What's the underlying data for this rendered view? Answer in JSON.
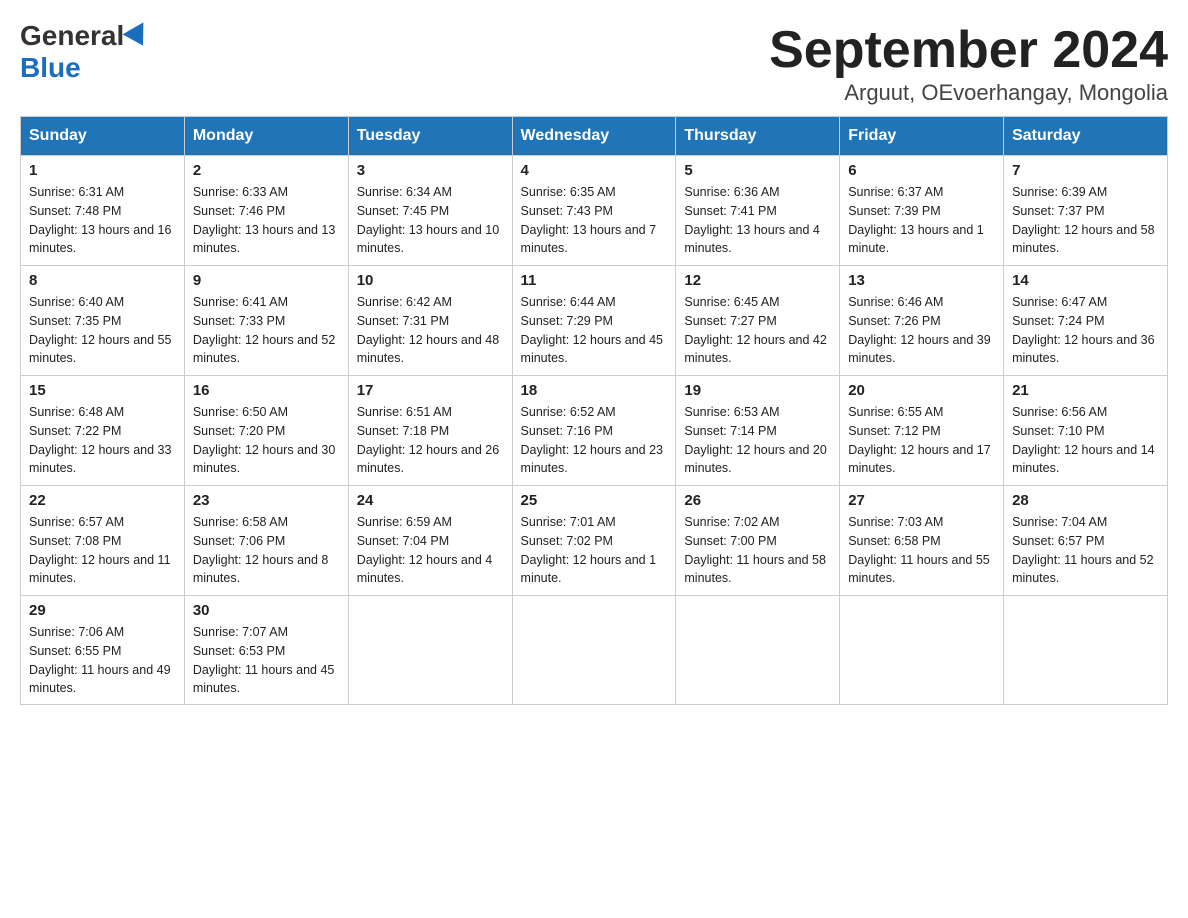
{
  "header": {
    "logo_general": "General",
    "logo_blue": "Blue",
    "month_title": "September 2024",
    "location": "Arguut, OEvoerhangay, Mongolia"
  },
  "weekdays": [
    "Sunday",
    "Monday",
    "Tuesday",
    "Wednesday",
    "Thursday",
    "Friday",
    "Saturday"
  ],
  "weeks": [
    [
      {
        "day": "1",
        "sunrise": "6:31 AM",
        "sunset": "7:48 PM",
        "daylight": "13 hours and 16 minutes."
      },
      {
        "day": "2",
        "sunrise": "6:33 AM",
        "sunset": "7:46 PM",
        "daylight": "13 hours and 13 minutes."
      },
      {
        "day": "3",
        "sunrise": "6:34 AM",
        "sunset": "7:45 PM",
        "daylight": "13 hours and 10 minutes."
      },
      {
        "day": "4",
        "sunrise": "6:35 AM",
        "sunset": "7:43 PM",
        "daylight": "13 hours and 7 minutes."
      },
      {
        "day": "5",
        "sunrise": "6:36 AM",
        "sunset": "7:41 PM",
        "daylight": "13 hours and 4 minutes."
      },
      {
        "day": "6",
        "sunrise": "6:37 AM",
        "sunset": "7:39 PM",
        "daylight": "13 hours and 1 minute."
      },
      {
        "day": "7",
        "sunrise": "6:39 AM",
        "sunset": "7:37 PM",
        "daylight": "12 hours and 58 minutes."
      }
    ],
    [
      {
        "day": "8",
        "sunrise": "6:40 AM",
        "sunset": "7:35 PM",
        "daylight": "12 hours and 55 minutes."
      },
      {
        "day": "9",
        "sunrise": "6:41 AM",
        "sunset": "7:33 PM",
        "daylight": "12 hours and 52 minutes."
      },
      {
        "day": "10",
        "sunrise": "6:42 AM",
        "sunset": "7:31 PM",
        "daylight": "12 hours and 48 minutes."
      },
      {
        "day": "11",
        "sunrise": "6:44 AM",
        "sunset": "7:29 PM",
        "daylight": "12 hours and 45 minutes."
      },
      {
        "day": "12",
        "sunrise": "6:45 AM",
        "sunset": "7:27 PM",
        "daylight": "12 hours and 42 minutes."
      },
      {
        "day": "13",
        "sunrise": "6:46 AM",
        "sunset": "7:26 PM",
        "daylight": "12 hours and 39 minutes."
      },
      {
        "day": "14",
        "sunrise": "6:47 AM",
        "sunset": "7:24 PM",
        "daylight": "12 hours and 36 minutes."
      }
    ],
    [
      {
        "day": "15",
        "sunrise": "6:48 AM",
        "sunset": "7:22 PM",
        "daylight": "12 hours and 33 minutes."
      },
      {
        "day": "16",
        "sunrise": "6:50 AM",
        "sunset": "7:20 PM",
        "daylight": "12 hours and 30 minutes."
      },
      {
        "day": "17",
        "sunrise": "6:51 AM",
        "sunset": "7:18 PM",
        "daylight": "12 hours and 26 minutes."
      },
      {
        "day": "18",
        "sunrise": "6:52 AM",
        "sunset": "7:16 PM",
        "daylight": "12 hours and 23 minutes."
      },
      {
        "day": "19",
        "sunrise": "6:53 AM",
        "sunset": "7:14 PM",
        "daylight": "12 hours and 20 minutes."
      },
      {
        "day": "20",
        "sunrise": "6:55 AM",
        "sunset": "7:12 PM",
        "daylight": "12 hours and 17 minutes."
      },
      {
        "day": "21",
        "sunrise": "6:56 AM",
        "sunset": "7:10 PM",
        "daylight": "12 hours and 14 minutes."
      }
    ],
    [
      {
        "day": "22",
        "sunrise": "6:57 AM",
        "sunset": "7:08 PM",
        "daylight": "12 hours and 11 minutes."
      },
      {
        "day": "23",
        "sunrise": "6:58 AM",
        "sunset": "7:06 PM",
        "daylight": "12 hours and 8 minutes."
      },
      {
        "day": "24",
        "sunrise": "6:59 AM",
        "sunset": "7:04 PM",
        "daylight": "12 hours and 4 minutes."
      },
      {
        "day": "25",
        "sunrise": "7:01 AM",
        "sunset": "7:02 PM",
        "daylight": "12 hours and 1 minute."
      },
      {
        "day": "26",
        "sunrise": "7:02 AM",
        "sunset": "7:00 PM",
        "daylight": "11 hours and 58 minutes."
      },
      {
        "day": "27",
        "sunrise": "7:03 AM",
        "sunset": "6:58 PM",
        "daylight": "11 hours and 55 minutes."
      },
      {
        "day": "28",
        "sunrise": "7:04 AM",
        "sunset": "6:57 PM",
        "daylight": "11 hours and 52 minutes."
      }
    ],
    [
      {
        "day": "29",
        "sunrise": "7:06 AM",
        "sunset": "6:55 PM",
        "daylight": "11 hours and 49 minutes."
      },
      {
        "day": "30",
        "sunrise": "7:07 AM",
        "sunset": "6:53 PM",
        "daylight": "11 hours and 45 minutes."
      },
      null,
      null,
      null,
      null,
      null
    ]
  ]
}
